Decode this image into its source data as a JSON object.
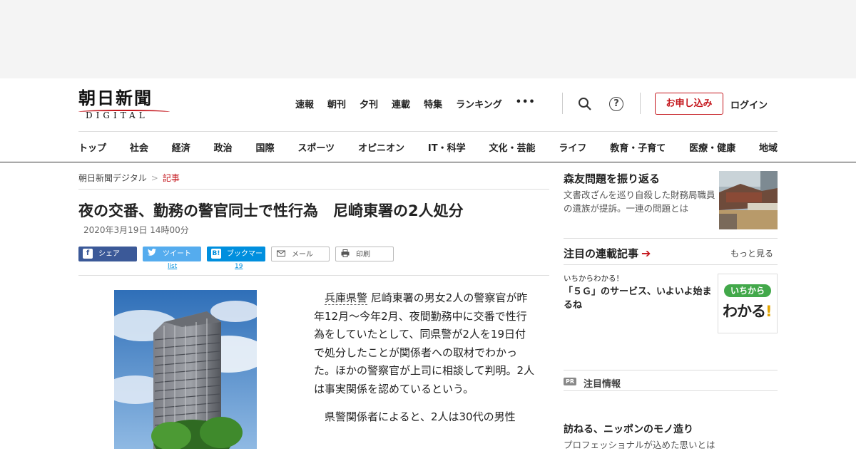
{
  "header": {
    "logo_main": "朝日新聞",
    "logo_sub": "DIGITAL",
    "top_nav": [
      "速報",
      "朝刊",
      "夕刊",
      "連載",
      "特集",
      "ランキング"
    ],
    "more_label": "•••",
    "help_label": "?",
    "apply_label": "お申し込み",
    "login_label": "ログイン",
    "categories": [
      "トップ",
      "社会",
      "経済",
      "政治",
      "国際",
      "スポーツ",
      "オピニオン",
      "IT・科学",
      "文化・芸能",
      "ライフ",
      "教育・子育て",
      "医療・健康",
      "地域"
    ]
  },
  "breadcrumb": {
    "home": "朝日新聞デジタル",
    "sep": ">",
    "current": "記事"
  },
  "article": {
    "title": "夜の交番、勤務の警官同士で性行為　尼崎東署の2人処分",
    "date": "2020年3月19日 14時00分",
    "share": {
      "facebook": "シェア",
      "facebook_icon": "f",
      "twitter": "ツイート",
      "twitter_count": "list",
      "hatena": "ブックマーク",
      "hatena_icon": "B!",
      "hatena_count": "19",
      "mail": "メール",
      "print": "印刷"
    },
    "para1_link": "兵庫県警",
    "para1_rest": " 尼崎東署の男女2人の警察官が昨年12月～今年2月、夜間勤務中に交番で性行為をしていたとして、同県警が2人を19日付で処分したことが関係者への取材でわかった。ほかの警察官が上司に相談して判明。2人は事実関係を認めているという。",
    "para2": "県警関係者によると、2人は30代の男性"
  },
  "sidebar": {
    "feature_title": "森友問題を振り返る",
    "feature_desc": "文書改ざんを巡り自殺した財務局職員の遺族が提訴。一連の問題とは",
    "series_title": "注目の連載記事",
    "series_arrow": "➔",
    "more_label": "もっと見る",
    "series_kicker": "いちからわかる！",
    "series_item": "「５Ｇ」のサービス、いよいよ始まるね",
    "series_badge": "いちから",
    "series_word": "わかる",
    "series_word_ex": "!",
    "pr_tag": "PR",
    "pr_title": "注目情報",
    "pr_item_title": "訪ねる、ニッポンのモノ造り",
    "pr_item_desc": "プロフェッショナルが込めた思いとは"
  }
}
